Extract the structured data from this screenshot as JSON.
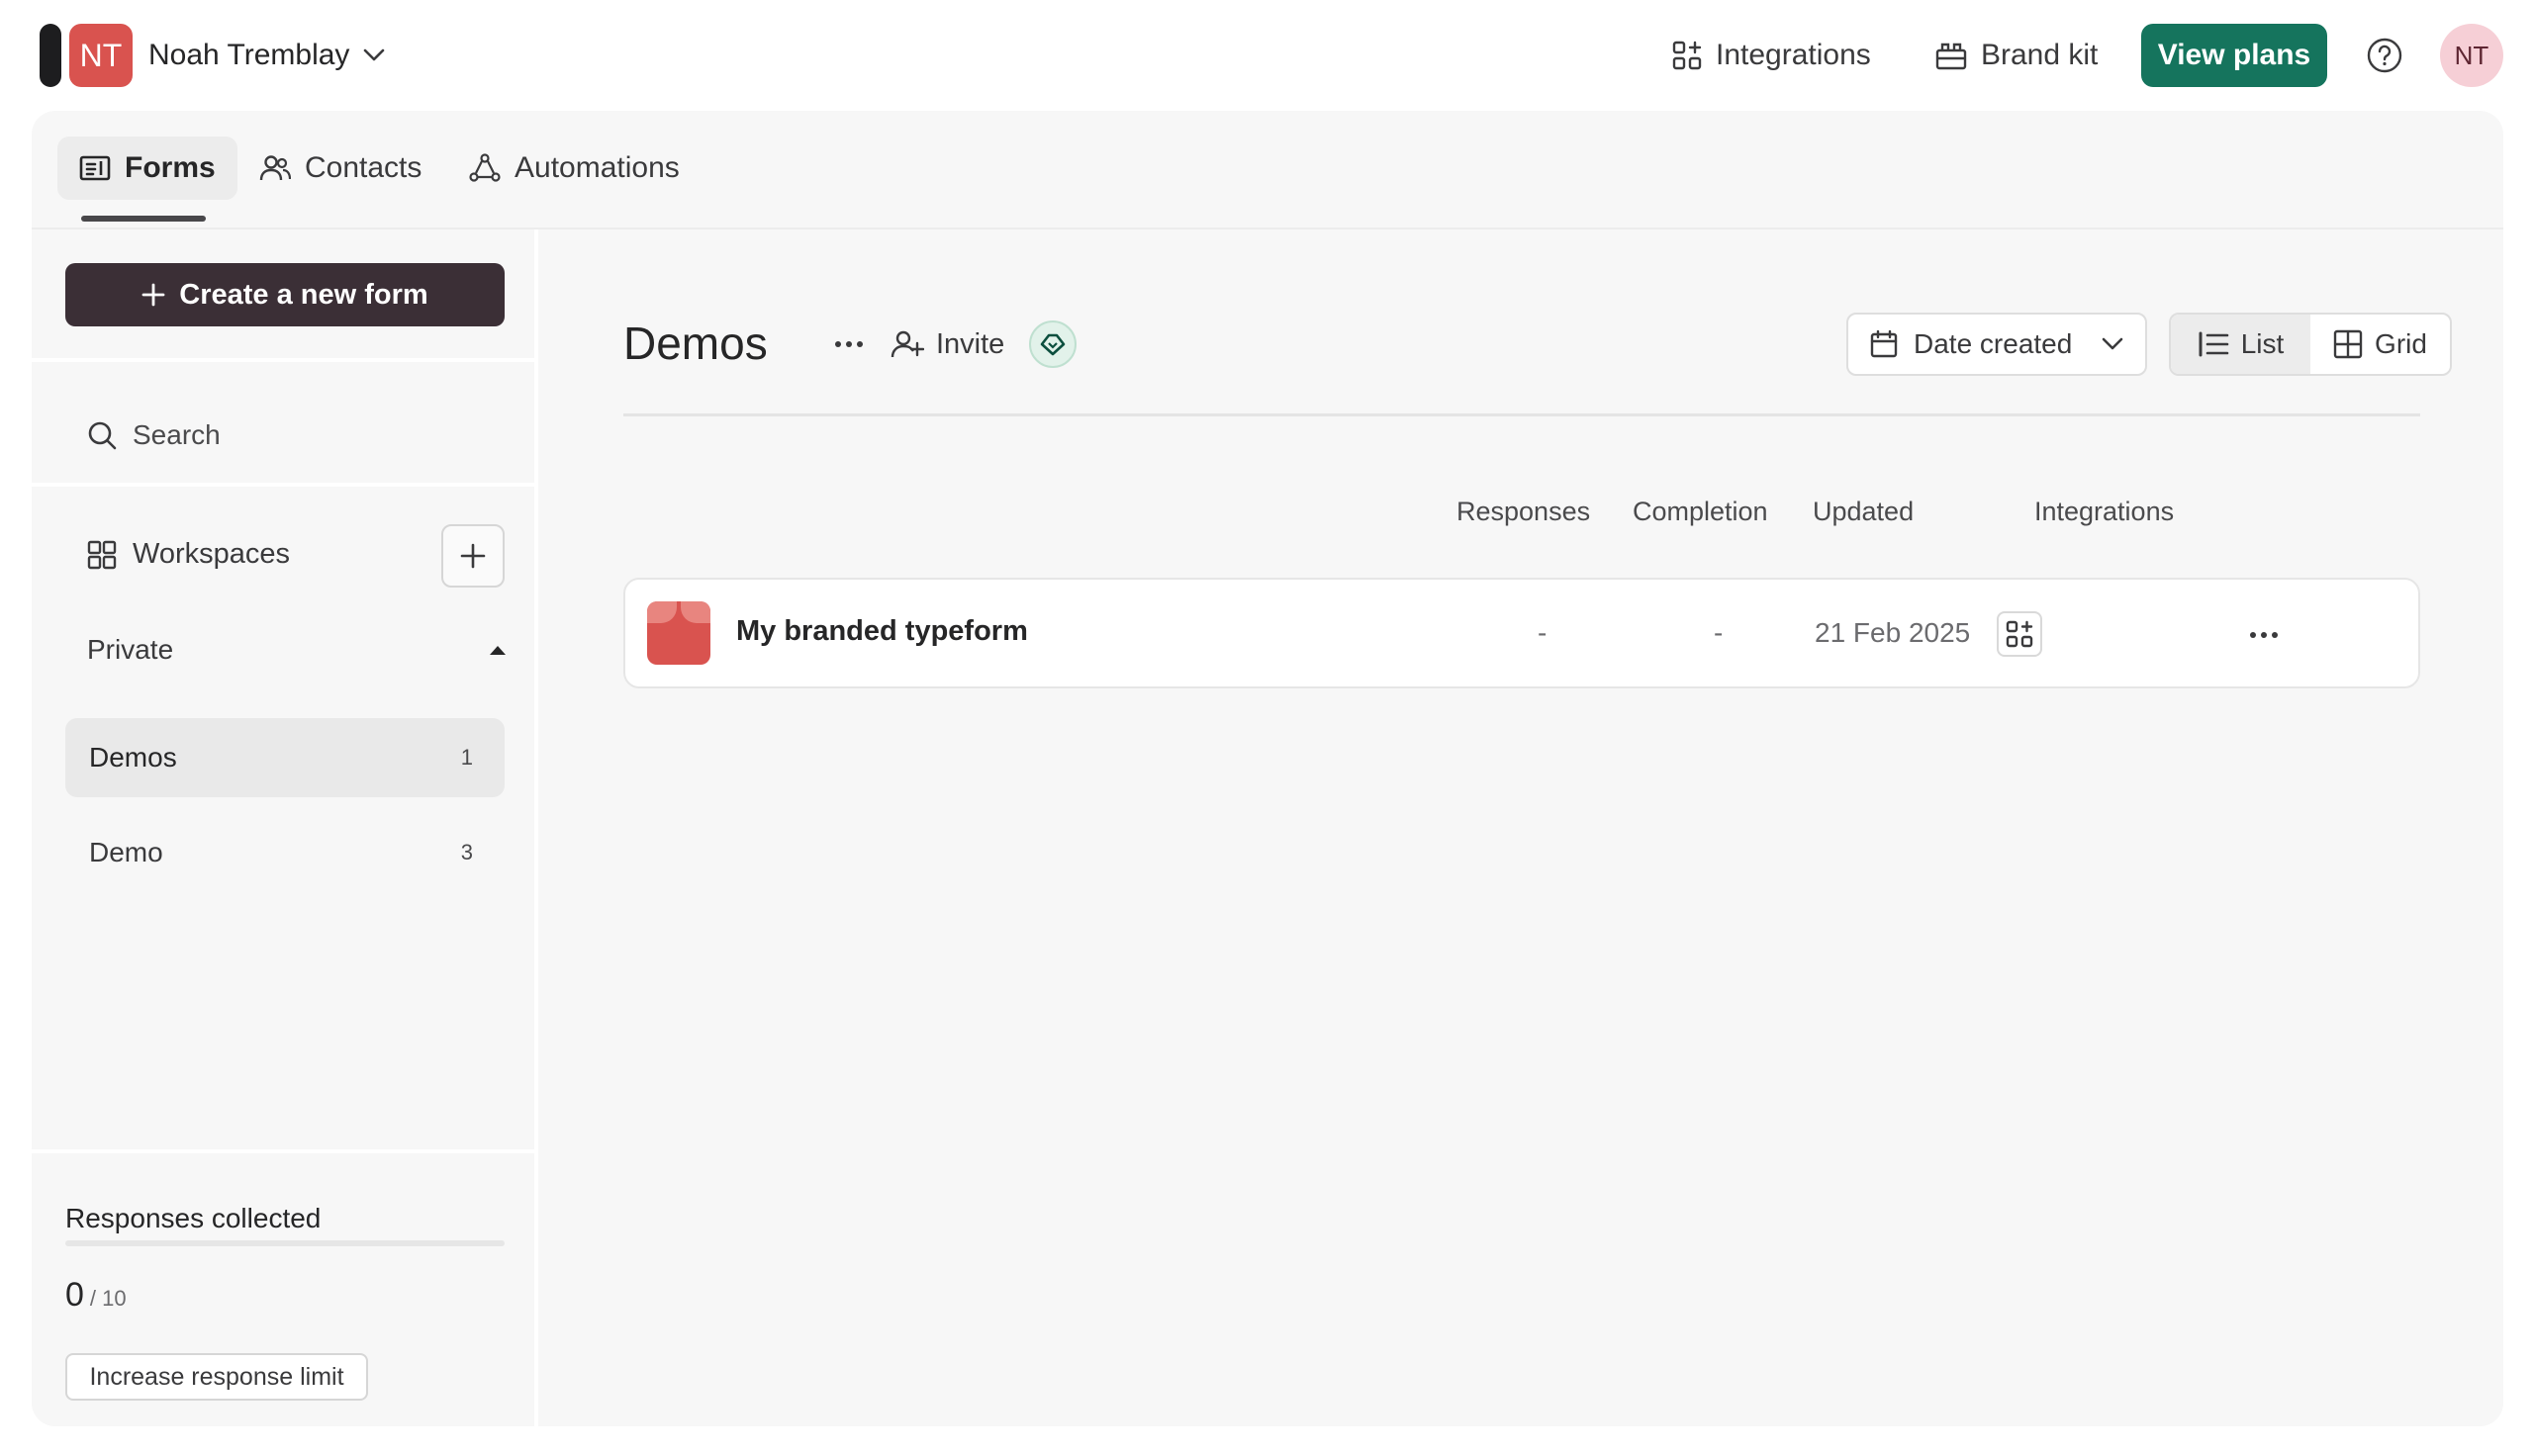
{
  "account": {
    "initials": "NT",
    "name": "Noah Tremblay"
  },
  "header": {
    "integrations_label": "Integrations",
    "brand_kit_label": "Brand kit",
    "view_plans_label": "View plans",
    "user_initials": "NT"
  },
  "tabs": [
    {
      "label": "Forms",
      "icon": "forms-icon",
      "active": true
    },
    {
      "label": "Contacts",
      "icon": "contacts-icon",
      "active": false
    },
    {
      "label": "Automations",
      "icon": "automations-icon",
      "active": false
    }
  ],
  "sidebar": {
    "create_label": "Create a new form",
    "search_placeholder": "Search",
    "workspaces_label": "Workspaces",
    "private_label": "Private",
    "workspaces": [
      {
        "name": "Demos",
        "count": "1",
        "active": true
      },
      {
        "name": "Demo",
        "count": "3",
        "active": false
      }
    ],
    "usage": {
      "label": "Responses collected",
      "collected": "0",
      "limit": "/ 10",
      "fraction": 0,
      "increase_label": "Increase response limit"
    }
  },
  "main": {
    "title": "Demos",
    "invite_label": "Invite",
    "sort_label": "Date created",
    "view_list_label": "List",
    "view_grid_label": "Grid",
    "columns": {
      "responses": "Responses",
      "completion": "Completion",
      "updated": "Updated",
      "integrations": "Integrations"
    },
    "forms": [
      {
        "name": "My branded typeform",
        "responses": "-",
        "completion": "-",
        "updated": "21 Feb 2025"
      }
    ]
  },
  "colors": {
    "accent": "#15745d",
    "create_button": "#3b2f36",
    "avatar": "#d9534f",
    "user_avatar": "#f6cfd6"
  }
}
